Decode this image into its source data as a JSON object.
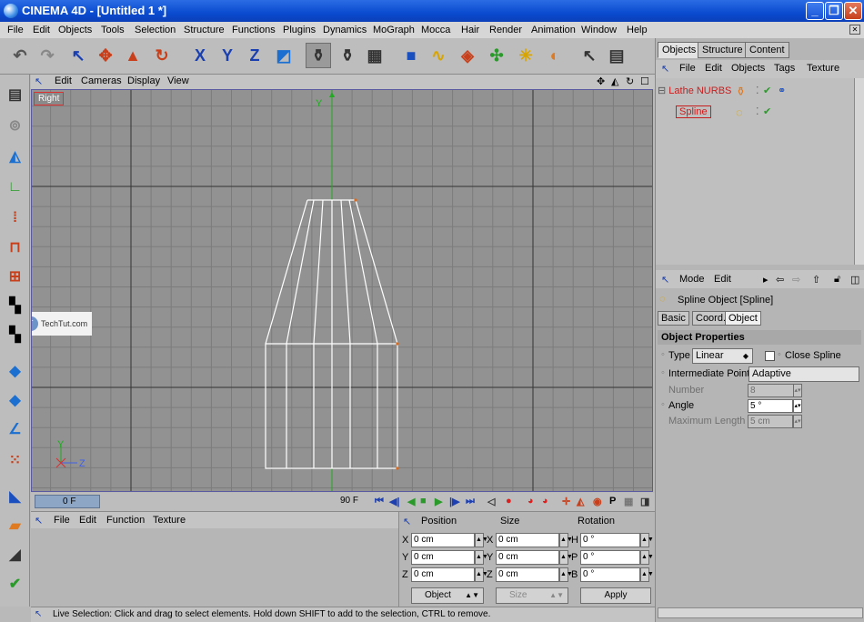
{
  "window": {
    "title": "CINEMA 4D - [Untitled 1 *]",
    "minimize": "_",
    "maximize": "❐",
    "close": "✕"
  },
  "menu": [
    "File",
    "Edit",
    "Objects",
    "Tools",
    "Selection",
    "Structure",
    "Functions",
    "Plugins",
    "Dynamics",
    "MoGraph",
    "Mocca",
    "Hair",
    "Render",
    "Animation",
    "Window",
    "Help"
  ],
  "viewport": {
    "menu": [
      "Edit",
      "Cameras",
      "Display",
      "View"
    ],
    "label": "Right",
    "axis_y": "Y",
    "axis_z": "Z",
    "watermark": "TechTut.com",
    "nav_icons": [
      "move-view-icon",
      "zoom-view-icon",
      "rotate-view-icon",
      "maximize-view-icon"
    ]
  },
  "timeline": {
    "current_frame": "0 F",
    "end_frame": "90 F"
  },
  "material_manager": {
    "menu": [
      "File",
      "Edit",
      "Function",
      "Texture"
    ]
  },
  "coordinates": {
    "headers": [
      "Position",
      "Size",
      "Rotation"
    ],
    "rows": [
      {
        "pos_label": "X",
        "pos": "0 cm",
        "size_label": "X",
        "size": "0 cm",
        "rot_label": "H",
        "rot": "0 °"
      },
      {
        "pos_label": "Y",
        "pos": "0 cm",
        "size_label": "Y",
        "size": "0 cm",
        "rot_label": "P",
        "rot": "0 °"
      },
      {
        "pos_label": "Z",
        "pos": "0 cm",
        "size_label": "Z",
        "size": "0 cm",
        "rot_label": "B",
        "rot": "0 °"
      }
    ],
    "mode": "Object",
    "size_mode": "Size",
    "apply": "Apply"
  },
  "status": "Live Selection: Click and drag to select elements. Hold down SHIFT to add to the selection, CTRL to remove.",
  "object_manager": {
    "tabs": [
      "Objects",
      "Structure",
      "Content"
    ],
    "menu": [
      "File",
      "Edit",
      "Objects",
      "Tags",
      "Texture"
    ],
    "objects": [
      {
        "name": "Lathe NURBS"
      },
      {
        "name": "Spline"
      }
    ]
  },
  "attributes": {
    "menu": [
      "Mode",
      "Edit"
    ],
    "object_title": "Spline Object [Spline]",
    "tabs": [
      "Basic",
      "Coord.",
      "Object"
    ],
    "section": "Object Properties",
    "type_label": "Type",
    "type_value": "Linear",
    "close_spline_label": "Close Spline",
    "intermediate_label": "Intermediate Points",
    "intermediate_value": "Adaptive",
    "number_label": "Number",
    "number_value": "8",
    "angle_label": "Angle",
    "angle_value": "5 °",
    "maxlen_label": "Maximum Length",
    "maxlen_value": "5 cm"
  },
  "colors": {
    "grid_bg": "#929292",
    "grid_line": "#7c7c7c",
    "axis_y": "#22aa22",
    "spline": "#ffffff",
    "object_name": "#c81e1e"
  }
}
